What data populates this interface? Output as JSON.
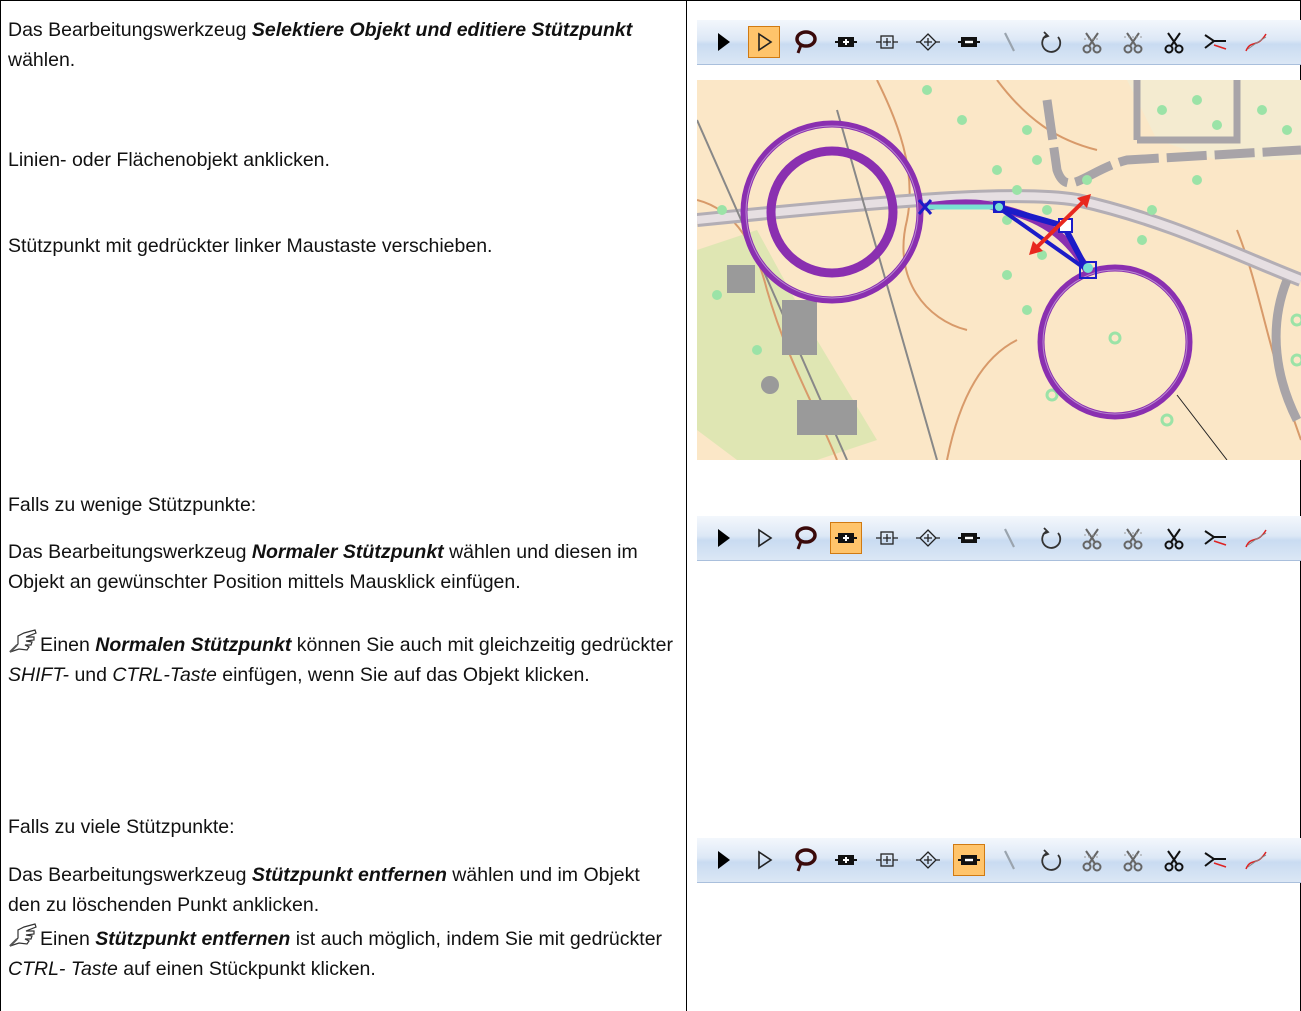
{
  "row1": {
    "step1_prefix": "Das Bearbeitungswerkzeug ",
    "step1_tool": "Selektiere Objekt und editiere Stützpunkt",
    "step1_suffix": " wählen.",
    "step2": "Linien- oder Flächenobjekt anklicken.",
    "step3": "Stützpunkt mit gedrückter linker Maustaste verschieben."
  },
  "row2": {
    "heading": "Falls zu wenige Stützpunkte:",
    "instr_prefix": "Das Bearbeitungswerkzeug ",
    "instr_tool": "Normaler Stützpunkt",
    "instr_suffix": " wählen und diesen im Objekt an gewünschter Position mittels Mausklick einfügen.",
    "note_prefix": "Einen ",
    "note_tool": "Normalen Stützpunkt",
    "note_mid1": " können Sie auch mit gleichzeitig gedrückter ",
    "note_key1": "SHIFT-",
    "note_mid2": " und ",
    "note_key2": "CTRL-Taste",
    "note_suffix": " einfügen, wenn Sie auf das Objekt klicken."
  },
  "row3": {
    "heading": "Falls zu viele Stützpunkte:",
    "instr_prefix": "Das Bearbeitungswerkzeug ",
    "instr_tool": "Stützpunkt entfernen",
    "instr_suffix": " wählen und im Objekt den zu löschenden Punkt anklicken.",
    "note_prefix": "Einen ",
    "note_tool": "Stützpunkt entfernen",
    "note_mid": " ist auch möglich, indem Sie mit gedrückter ",
    "note_key": "CTRL- Taste",
    "note_suffix": " auf einen Stückpunkt klicken."
  },
  "toolbar_tools": [
    "select-object-icon",
    "select-edit-vertex-icon",
    "lasso-icon",
    "add-normal-vertex-icon",
    "add-corner-vertex-icon",
    "add-dash-vertex-icon",
    "remove-vertex-icon",
    "draw-line-icon",
    "rotate-icon",
    "cut-object-icon",
    "cut-hole-icon",
    "scissors-icon",
    "merge-lines-icon",
    "smooth-line-icon"
  ],
  "toolbars": [
    {
      "active_tool": "select-edit-vertex-icon"
    },
    {
      "active_tool": "add-normal-vertex-icon"
    },
    {
      "active_tool": "remove-vertex-icon"
    }
  ],
  "colors": {
    "active_button": "#ffc46b",
    "selection_purple": "#8a2fb0",
    "vertex_blue": "#1c1cc8",
    "arrow_red": "#e8281e",
    "map_background": "#fbe7c7"
  }
}
